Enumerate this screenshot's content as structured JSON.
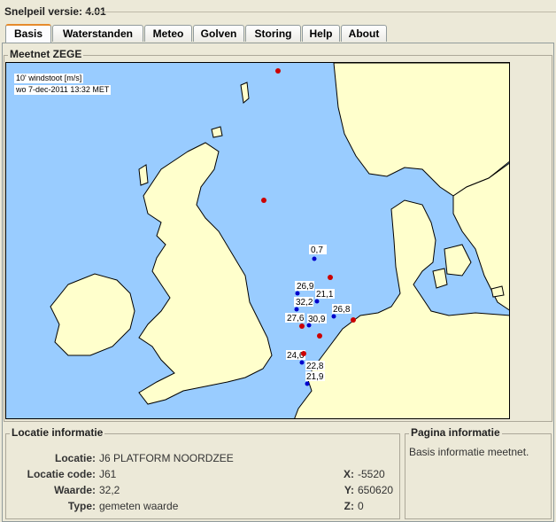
{
  "app": {
    "title": "Snelpeil versie: 4.01"
  },
  "tabs": [
    {
      "label": "Basis",
      "active": true
    },
    {
      "label": "Waterstanden",
      "active": false
    },
    {
      "label": "Meteo",
      "active": false
    },
    {
      "label": "Golven",
      "active": false
    },
    {
      "label": "Storing",
      "active": false
    },
    {
      "label": "Help",
      "active": false
    },
    {
      "label": "About",
      "active": false
    }
  ],
  "map": {
    "group_title": "Meetnet ZEGE",
    "legend_line1": "10' windstoot [m/s]",
    "legend_line2": "wo 7-dec-2011 13:32 MET",
    "colors": {
      "sea": "#99ccff",
      "land": "#ffffcc",
      "station_blue": "#0000cc",
      "station_red": "#cc0000"
    },
    "stations": [
      {
        "label": "0,7",
        "color": "blue"
      },
      {
        "label": "26,9",
        "color": "blue"
      },
      {
        "label": "21,1",
        "color": "blue"
      },
      {
        "label": "32,2",
        "color": "blue"
      },
      {
        "label": "26,8",
        "color": "blue"
      },
      {
        "label": "27,6",
        "color": "red"
      },
      {
        "label": "30,9",
        "color": "blue"
      },
      {
        "label": "24,6",
        "color": "red"
      },
      {
        "label": "22,8",
        "color": "blue"
      },
      {
        "label": "21,9",
        "color": "blue"
      }
    ]
  },
  "locatie": {
    "group_title": "Locatie informatie",
    "locatie_label": "Locatie:",
    "locatie_value": "J6 PLATFORM NOORDZEE",
    "code_label": "Locatie code:",
    "code_value": "J61",
    "waarde_label": "Waarde:",
    "waarde_value": "32,2",
    "type_label": "Type:",
    "type_value": "gemeten waarde",
    "x_label": "X:",
    "x_value": "-5520",
    "y_label": "Y:",
    "y_value": "650620",
    "z_label": "Z:",
    "z_value": "0"
  },
  "pagina": {
    "group_title": "Pagina informatie",
    "text": "Basis informatie meetnet."
  }
}
